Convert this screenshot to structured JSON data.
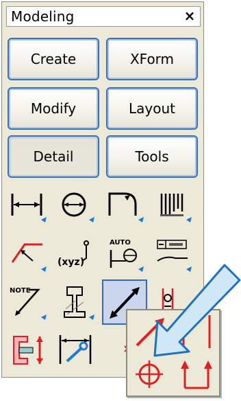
{
  "panel": {
    "title": "Modeling",
    "close_label": "×"
  },
  "tabs": [
    {
      "label": "Create"
    },
    {
      "label": "XForm"
    },
    {
      "label": "Modify"
    },
    {
      "label": "Layout"
    },
    {
      "label": "Detail",
      "selected": true
    },
    {
      "label": "Tools"
    }
  ],
  "tools": [
    {
      "icon": "linear-dimension-icon"
    },
    {
      "icon": "diameter-dimension-icon"
    },
    {
      "icon": "radius-dimension-icon"
    },
    {
      "icon": "ordinate-dimension-icon"
    },
    {
      "icon": "leader-icon"
    },
    {
      "icon": "coordinate-label-icon",
      "text": "(xyz)"
    },
    {
      "icon": "auto-dimension-icon",
      "text": "AUTO"
    },
    {
      "icon": "datum-feature-icon"
    },
    {
      "icon": "note-leader-icon",
      "text": "NOTE"
    },
    {
      "icon": "weld-symbol-icon"
    },
    {
      "icon": "arrow-edit-icon",
      "active": true
    },
    {
      "icon": "break-line-icon"
    },
    {
      "icon": "section-view-icon"
    },
    {
      "icon": "dimension-wrench-icon"
    },
    {
      "icon": "partial-tool-icon"
    }
  ],
  "flyout": {
    "icons": [
      "red-arrow-icon",
      "red-bracket-icon",
      "target-crosshair-icon",
      "up-arrows-icon"
    ]
  },
  "colors": {
    "accent_blue": "#316ac5",
    "button_border": "#3f6fb5",
    "panel_bg": "#ece9d8",
    "icon_red": "#e02020",
    "callout_fill": "#cfe7f7"
  }
}
